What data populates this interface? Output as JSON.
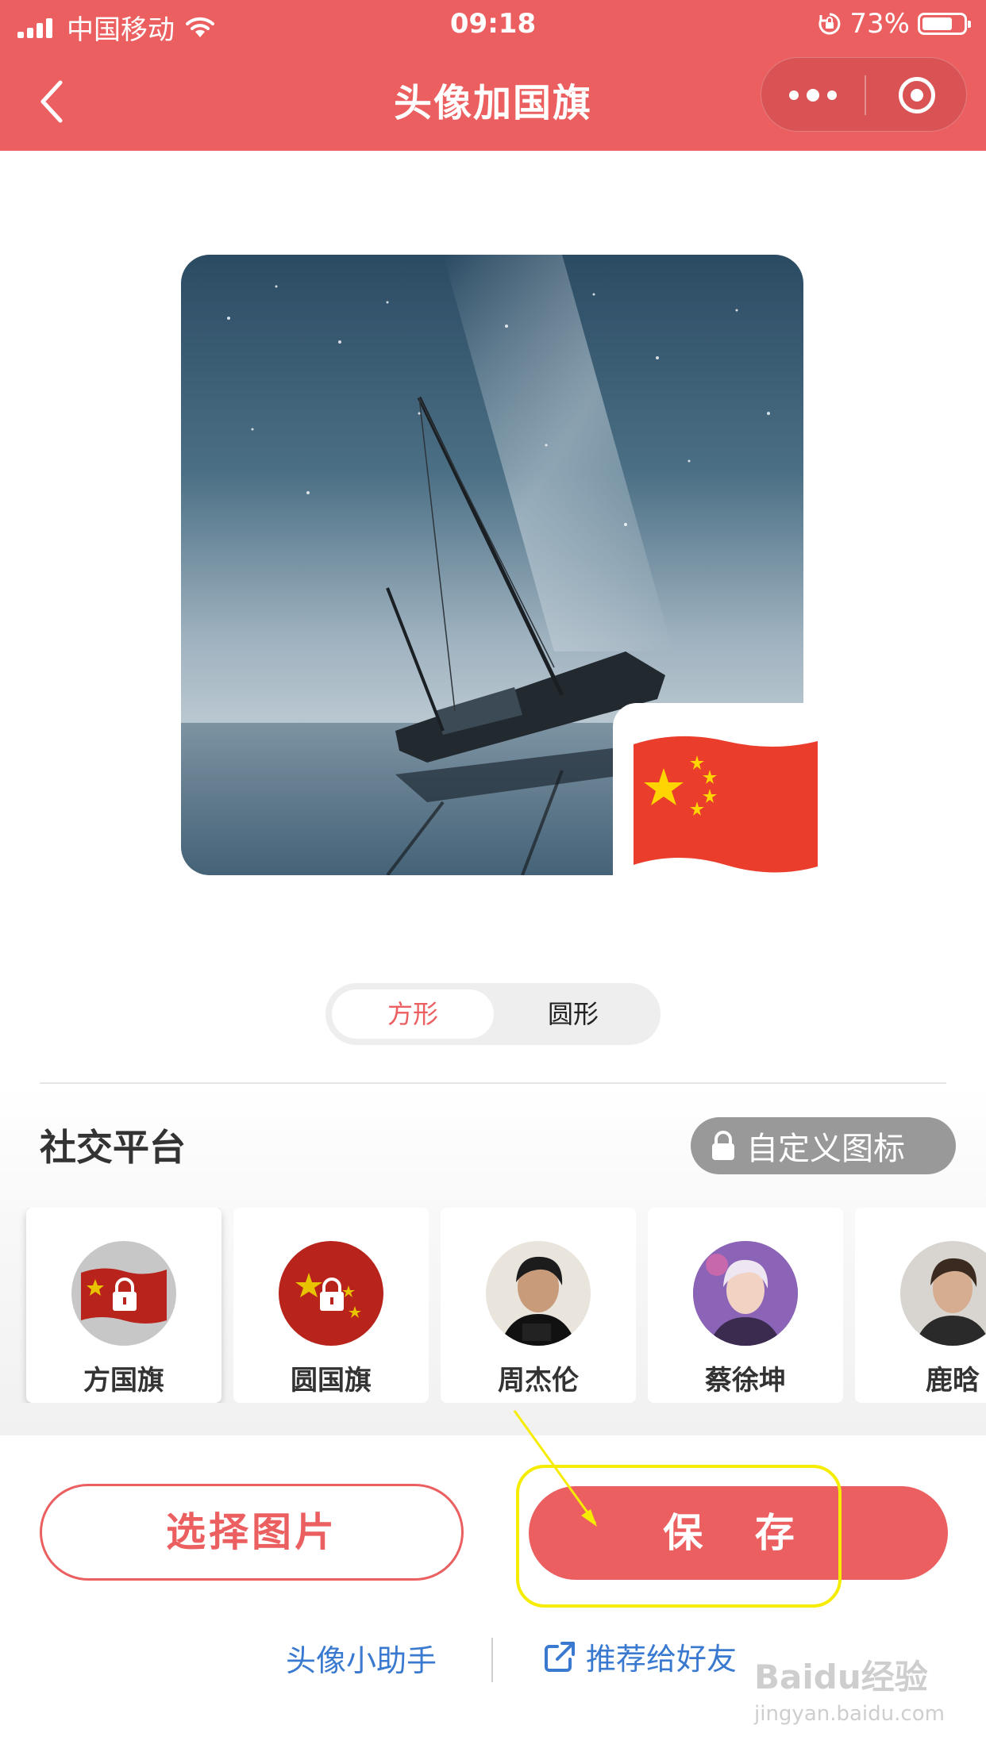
{
  "status_bar": {
    "carrier": "中国移动",
    "time": "09:18",
    "battery_percent": "73%",
    "battery_level": 0.73
  },
  "nav": {
    "title": "头像加国旗"
  },
  "preview": {
    "flag_colors": {
      "red": "#ea3d2c",
      "star": "#ffd400"
    }
  },
  "shape_toggle": {
    "options": [
      "方形",
      "圆形"
    ],
    "selected": "方形"
  },
  "platform": {
    "title": "社交平台",
    "custom_icon_label": "自定义图标",
    "items": [
      {
        "label": "方国旗",
        "selected": true
      },
      {
        "label": "圆国旗",
        "selected": false
      },
      {
        "label": "周杰伦",
        "selected": false
      },
      {
        "label": "蔡徐坤",
        "selected": false
      },
      {
        "label": "鹿晗",
        "selected": false
      }
    ]
  },
  "actions": {
    "choose_label": "选择图片",
    "save_label": "保 存"
  },
  "footer": {
    "helper_label": "头像小助手",
    "share_label": "推荐给好友"
  },
  "watermark": {
    "brand": "Baidu经验",
    "url": "jingyan.baidu.com"
  },
  "colors": {
    "accent": "#ec5f60",
    "link": "#3a79d0",
    "annotation": "#f5ec00"
  }
}
